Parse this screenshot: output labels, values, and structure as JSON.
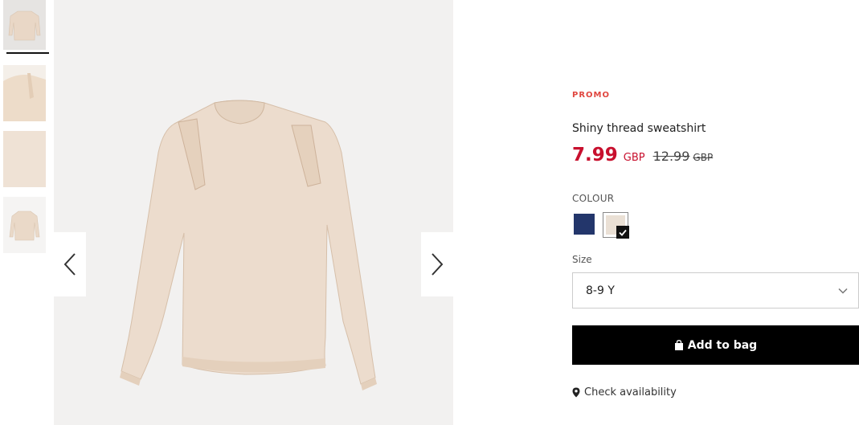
{
  "gallery": {
    "thumbnails": [
      {
        "name": "front-view",
        "selected": true
      },
      {
        "name": "shoulder-detail",
        "selected": false
      },
      {
        "name": "fabric-detail",
        "selected": false
      },
      {
        "name": "flat-view",
        "selected": false
      }
    ],
    "prev_icon": "chevron-left-icon",
    "next_icon": "chevron-right-icon"
  },
  "product": {
    "badge": "PROMO",
    "title": "Shiny thread sweatshirt",
    "price": {
      "current": "7.99",
      "current_currency": "GBP",
      "original": "12.99",
      "original_currency": "GBP"
    }
  },
  "colour": {
    "label": "COLOUR",
    "options": [
      {
        "name": "navy",
        "hex": "#23366b",
        "selected": false
      },
      {
        "name": "beige",
        "hex": "#eae0d5",
        "selected": true
      }
    ]
  },
  "size": {
    "label": "Size",
    "selected": "8-9 Y"
  },
  "actions": {
    "add_to_bag": "Add to bag",
    "check_availability": "Check availability"
  },
  "colors": {
    "promo": "#e0463f",
    "price": "#c8102e",
    "button": "#000000"
  }
}
